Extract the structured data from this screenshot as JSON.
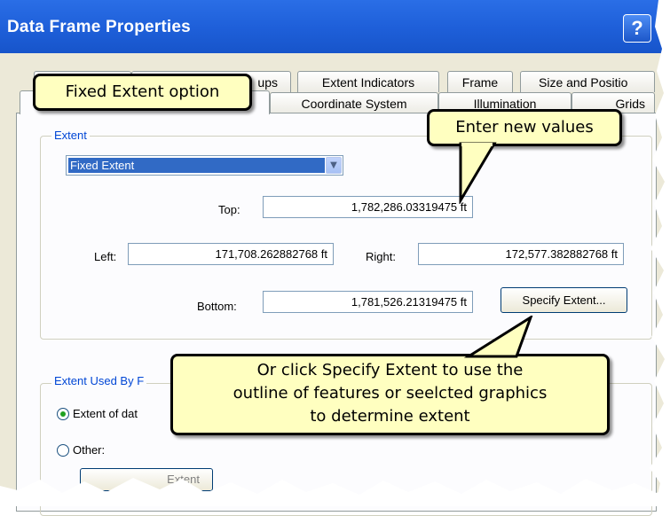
{
  "window": {
    "title": "Data Frame Properties",
    "help_glyph": "?"
  },
  "tabs": {
    "row1": [
      "",
      "ups",
      "Extent Indicators",
      "Frame",
      "Size and Positio"
    ],
    "row2": [
      "",
      "Coordinate System",
      "Illumination",
      "Grids"
    ]
  },
  "extent": {
    "legend": "Extent",
    "mode": "Fixed Extent",
    "top_label": "Top:",
    "top_value": "1,782,286.03319475 ft",
    "left_label": "Left:",
    "left_value": "171,708.262882768 ft",
    "right_label": "Right:",
    "right_value": "172,577.382882768 ft",
    "bottom_label": "Bottom:",
    "bottom_value": "1,781,526.21319475 ft",
    "specify_button": "Specify Extent..."
  },
  "extent_used_by": {
    "legend": "Extent Used By F",
    "option1": "Extent of dat",
    "option2": "Other:",
    "partial_button": "Extent"
  },
  "callouts": {
    "fixed_extent": "Fixed Extent option",
    "enter_values": "Enter new values",
    "specify_line1": "Or click Specify Extent to use the",
    "specify_line2": "outline of features or seelcted graphics",
    "specify_line3": "to determine extent"
  },
  "colors": {
    "title_bar": "#1e5fd9",
    "dialog_bg": "#ece9d8",
    "callout_bg": "#ffffc0",
    "selection": "#316ac5"
  }
}
